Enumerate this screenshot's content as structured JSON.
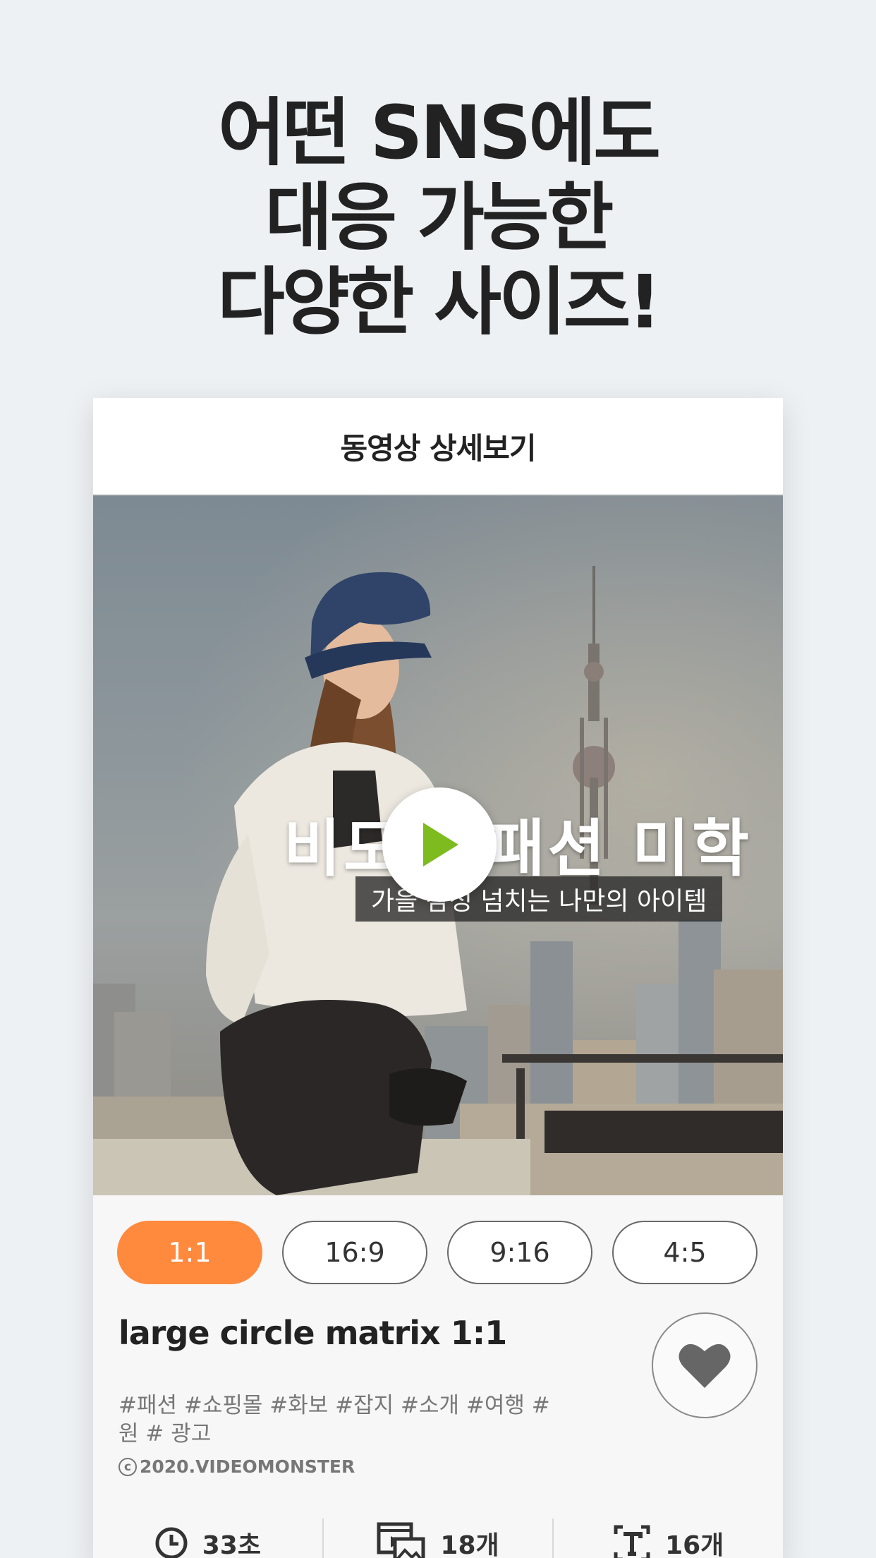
{
  "headline": {
    "line1": "어떤 SNS에도",
    "line2": "대응 가능한",
    "line3": "다양한 사이즈!"
  },
  "card": {
    "header_title": "동영상 상세보기",
    "video": {
      "overlay_title": "비도시 패션 미학",
      "overlay_subtitle": "가을 감성 넘치는 나만의 아이템",
      "play_icon": "play-icon",
      "play_color": "#7dbb1f"
    },
    "ratios": [
      {
        "label": "1:1",
        "active": true
      },
      {
        "label": "16:9",
        "active": false
      },
      {
        "label": "9:16",
        "active": false
      },
      {
        "label": "4:5",
        "active": false
      }
    ],
    "template_title": "large circle matrix 1:1",
    "tags": "#패션 #쇼핑몰 #화보 #잡지 #소개 #여행 #원 # 광고",
    "copyright_symbol": "c",
    "copyright": "2020.VIDEOMONSTER",
    "like_icon": "heart-icon",
    "stats": {
      "duration": "33초",
      "media_count": "18개",
      "text_count": "16개"
    },
    "accent_color": "#ff8a3d"
  }
}
